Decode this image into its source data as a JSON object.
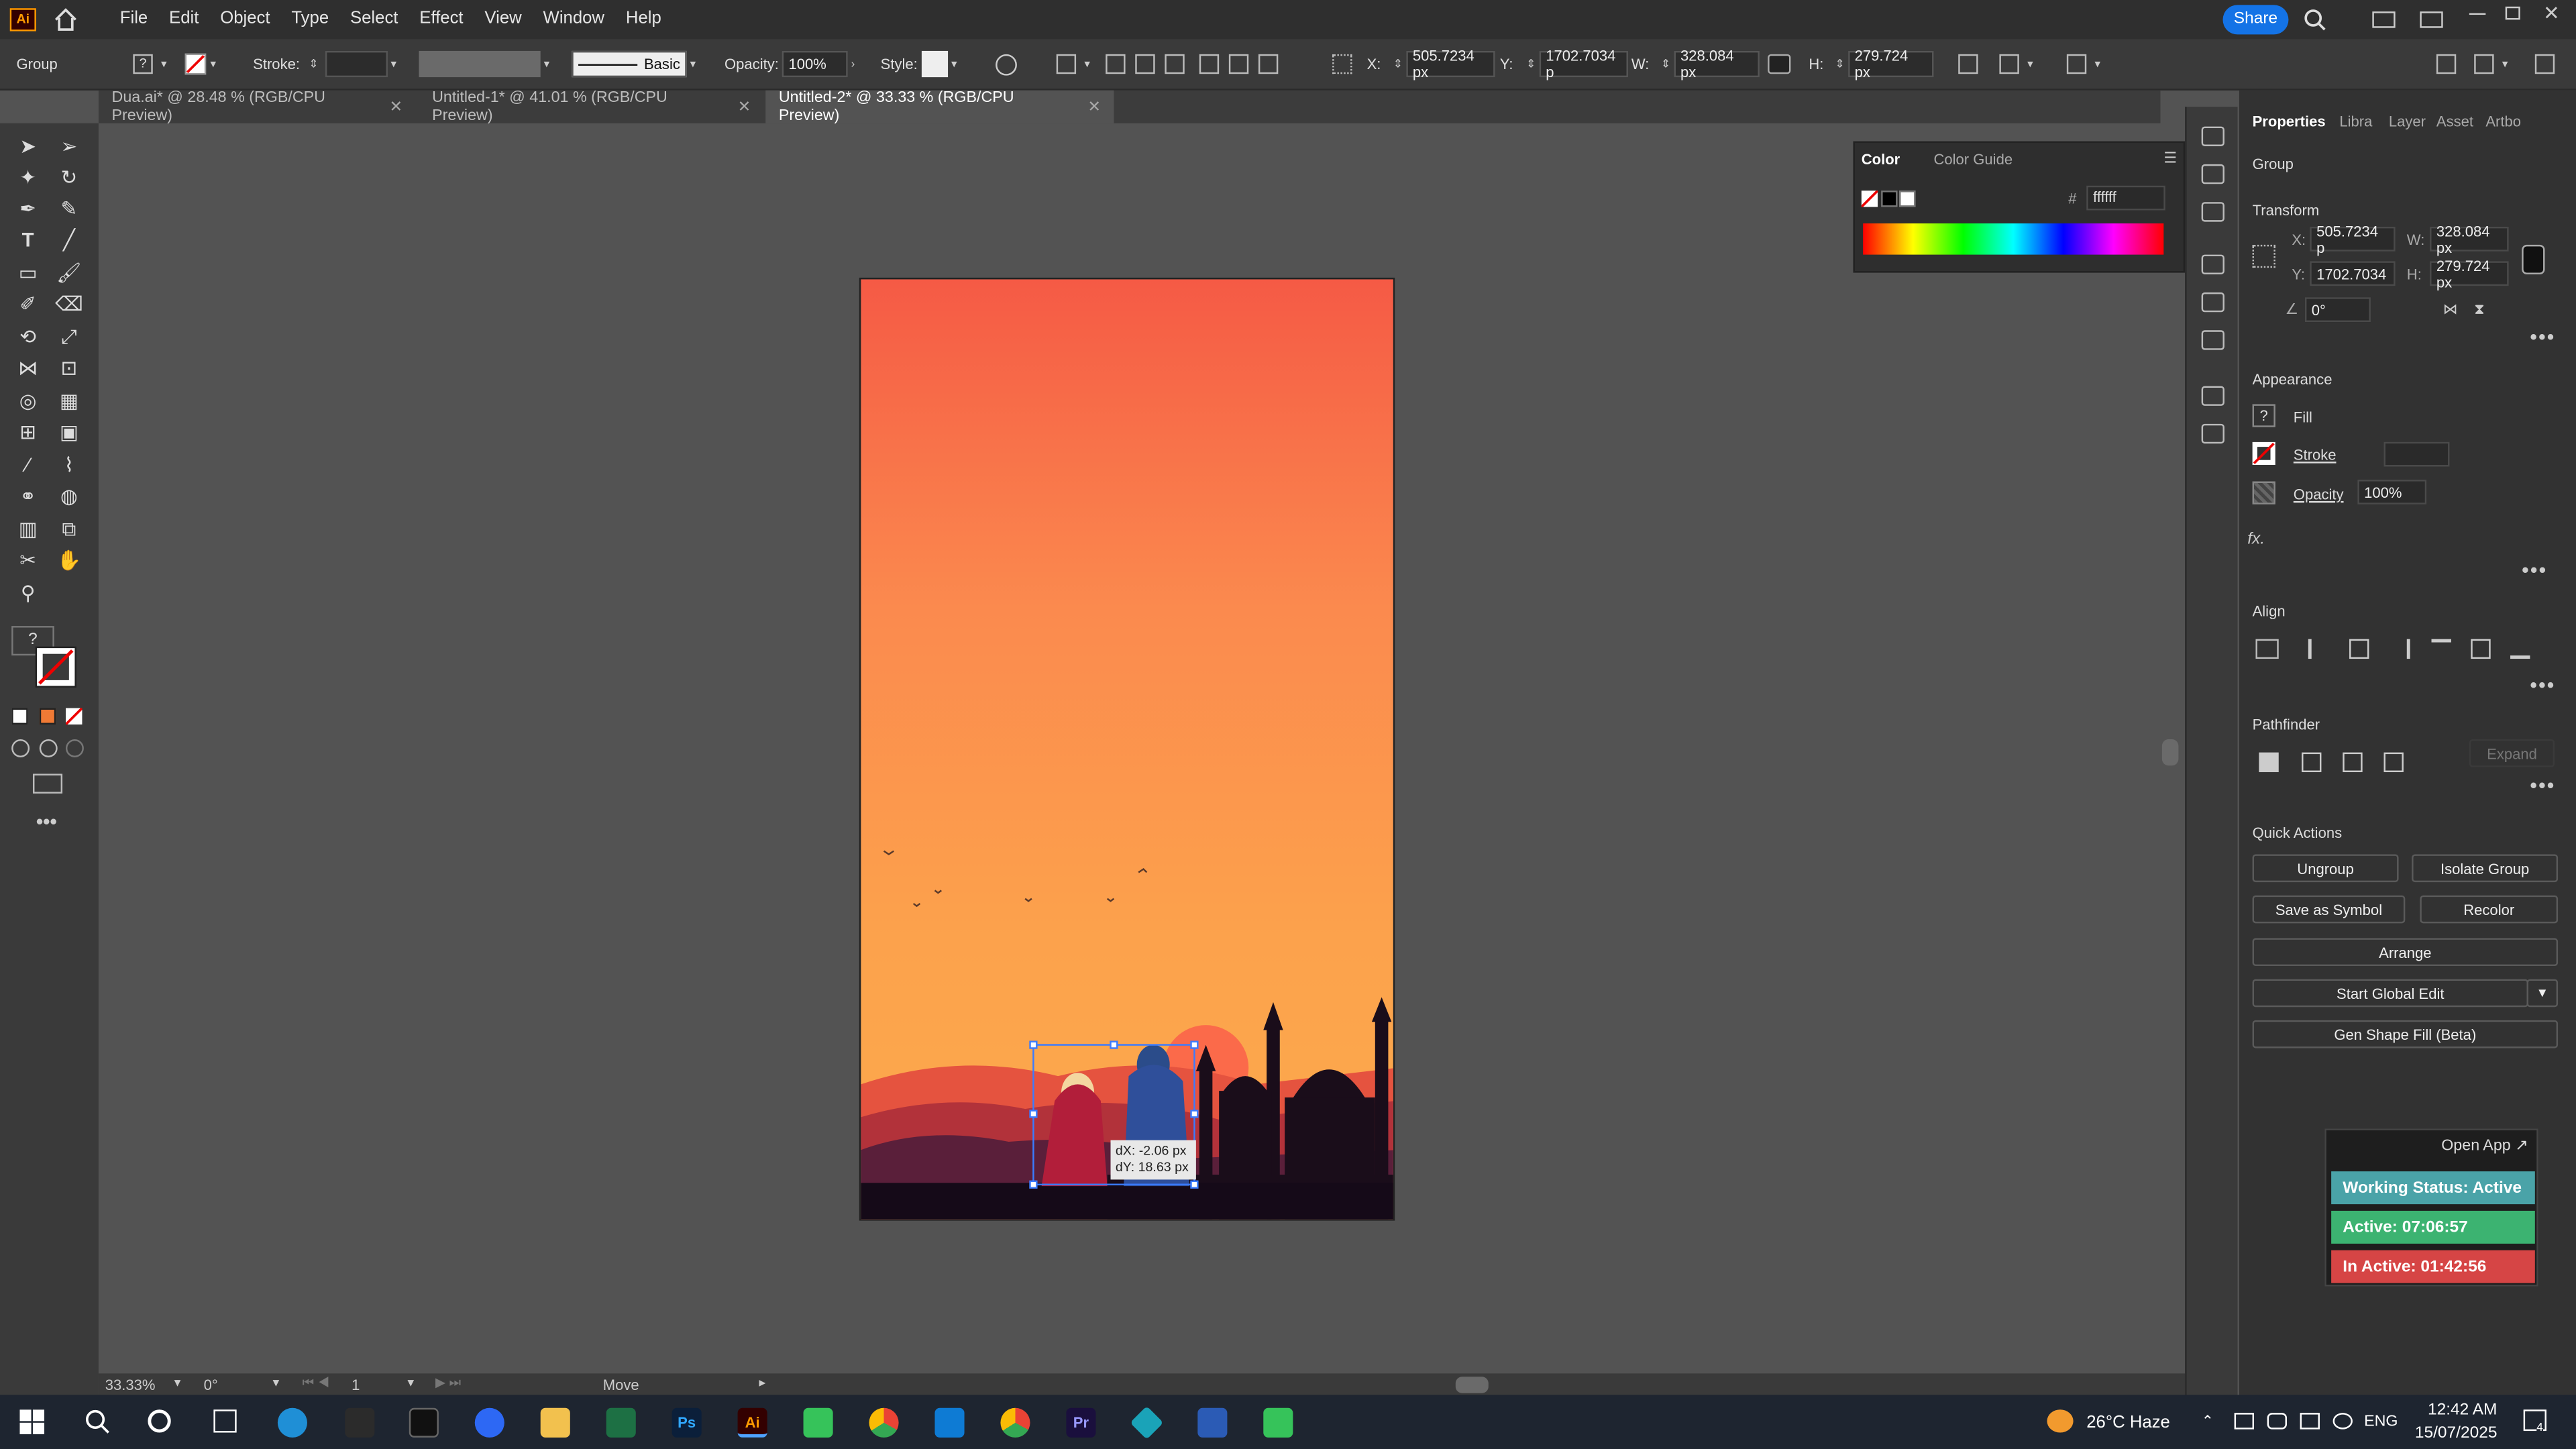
{
  "app": {
    "logo": "Ai",
    "share_label": "Share"
  },
  "menu": [
    "File",
    "Edit",
    "Object",
    "Type",
    "Select",
    "Effect",
    "View",
    "Window",
    "Help"
  ],
  "control_bar": {
    "selection": "Group",
    "stroke_label": "Stroke:",
    "brush_label": "Basic",
    "opacity_label": "Opacity:",
    "opacity_value": "100%",
    "style_label": "Style:",
    "x_label": "X:",
    "x_value": "505.7234 px",
    "y_label": "Y:",
    "y_value": "1702.7034 p",
    "w_label": "W:",
    "w_value": "328.084 px",
    "h_label": "H:",
    "h_value": "279.724 px"
  },
  "tabs": [
    {
      "label": "Dua.ai* @ 28.48 % (RGB/CPU Preview)",
      "active": false
    },
    {
      "label": "Untitled-1* @ 41.01 % (RGB/CPU Preview)",
      "active": false
    },
    {
      "label": "Untitled-2* @ 33.33 % (RGB/CPU Preview)",
      "active": true
    }
  ],
  "color_panel": {
    "tab1": "Color",
    "tab2": "Color Guide",
    "hash": "#",
    "hex": "ffffff"
  },
  "properties": {
    "tabs": [
      "Properties",
      "Libra",
      "Layer",
      "Asset",
      "Artbo"
    ],
    "object": "Group",
    "transform_title": "Transform",
    "x_label": "X:",
    "x": "505.7234 p",
    "y_label": "Y:",
    "y": "1702.7034",
    "w_label": "W:",
    "w": "328.084 px",
    "h_label": "H:",
    "h": "279.724 px",
    "angle": "0°",
    "appearance_title": "Appearance",
    "fill_label": "Fill",
    "stroke_label": "Stroke",
    "opacity_label": "Opacity",
    "opacity_value": "100%",
    "fx": "fx.",
    "align_title": "Align",
    "pathfinder_title": "Pathfinder",
    "expand_label": "Expand",
    "quick_actions_title": "Quick Actions",
    "buttons": {
      "ungroup": "Ungroup",
      "isolate": "Isolate Group",
      "save_symbol": "Save as Symbol",
      "recolor": "Recolor",
      "arrange": "Arrange",
      "global_edit": "Start Global Edit",
      "gen_shape": "Gen Shape Fill (Beta)"
    }
  },
  "canvas": {
    "tooltip_dx": "dX: -2.06 px",
    "tooltip_dy": "dY: 18.63 px"
  },
  "status": {
    "zoom": "33.33%",
    "rotate": "0°",
    "artboard": "1",
    "tool": "Move"
  },
  "widget": {
    "open_app": "Open App ↗",
    "working": "Working Status: Active",
    "active": "Active: 07:06:57",
    "inactive": "In Active: 01:42:56"
  },
  "taskbar": {
    "weather": "26°C Haze",
    "lang": "ENG",
    "time": "12:42 AM",
    "date": "15/07/2025",
    "notif_count": "4"
  },
  "colors": {
    "accent": "#1473e6",
    "working": "#4aa3a8",
    "active": "#3cb371",
    "inactive": "#d64545"
  }
}
